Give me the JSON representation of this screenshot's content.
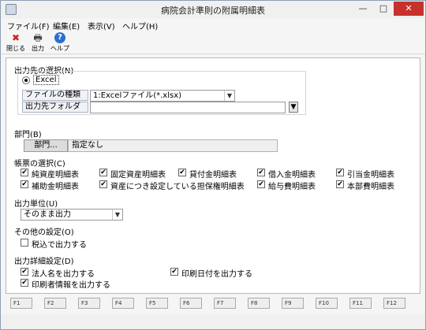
{
  "window": {
    "title": "病院会計準則の附属明細表"
  },
  "window_controls": {
    "minimize": "—",
    "maximize": "□",
    "close": "✕"
  },
  "menu": [
    {
      "label": "ファイル(F)"
    },
    {
      "label": "編集(E)"
    },
    {
      "label": "表示(V)"
    },
    {
      "label": "ヘルプ(H)"
    }
  ],
  "toolbar": {
    "close": {
      "label": "閉じる",
      "icon": "✖",
      "icon_color": "#d22020"
    },
    "output": {
      "label": "出力",
      "icon": "🖶"
    },
    "help": {
      "label": "ヘルプ",
      "icon": "?"
    }
  },
  "output_destination": {
    "title": "出力先の選択(N)",
    "radio_label": "Excel",
    "file_type_label": "ファイルの種類",
    "file_type_value": "1:Excelファイル(*.xlsx)",
    "folder_label": "出力先フォルダ",
    "folder_value": "",
    "browse_icon": "▼"
  },
  "department": {
    "title": "部門(B)",
    "button_label": "部門...",
    "value": "指定なし"
  },
  "reports": {
    "title": "帳票の選択(C)",
    "items": [
      {
        "label": "純資産明細表",
        "checked": true
      },
      {
        "label": "固定資産明細表",
        "checked": true
      },
      {
        "label": "貸付金明細表",
        "checked": true
      },
      {
        "label": "借入金明細表",
        "checked": true
      },
      {
        "label": "引当金明細表",
        "checked": true
      },
      {
        "label": "補助金明細表",
        "checked": true
      },
      {
        "label": "資産につき設定している担保権明細表",
        "checked": true
      },
      {
        "label": "給与費明細表",
        "checked": true
      },
      {
        "label": "本部費明細表",
        "checked": true
      }
    ]
  },
  "output_unit": {
    "title": "出力単位(U)",
    "value": "そのまま出力"
  },
  "other_settings": {
    "title": "その他の設定(O)",
    "tax_included": {
      "label": "税込で出力する",
      "checked": false
    }
  },
  "detail_settings": {
    "title": "出力詳細設定(D)",
    "corp_name": {
      "label": "法人名を出力する",
      "checked": true
    },
    "print_date": {
      "label": "印刷日付を出力する",
      "checked": true
    },
    "printer_info": {
      "label": "印刷者情報を出力する",
      "checked": true
    }
  },
  "function_keys": [
    "F1",
    "F2",
    "F3",
    "F4",
    "F5",
    "F6",
    "F7",
    "F8",
    "F9",
    "F10",
    "F11",
    "F12"
  ],
  "checkmark": "✔"
}
